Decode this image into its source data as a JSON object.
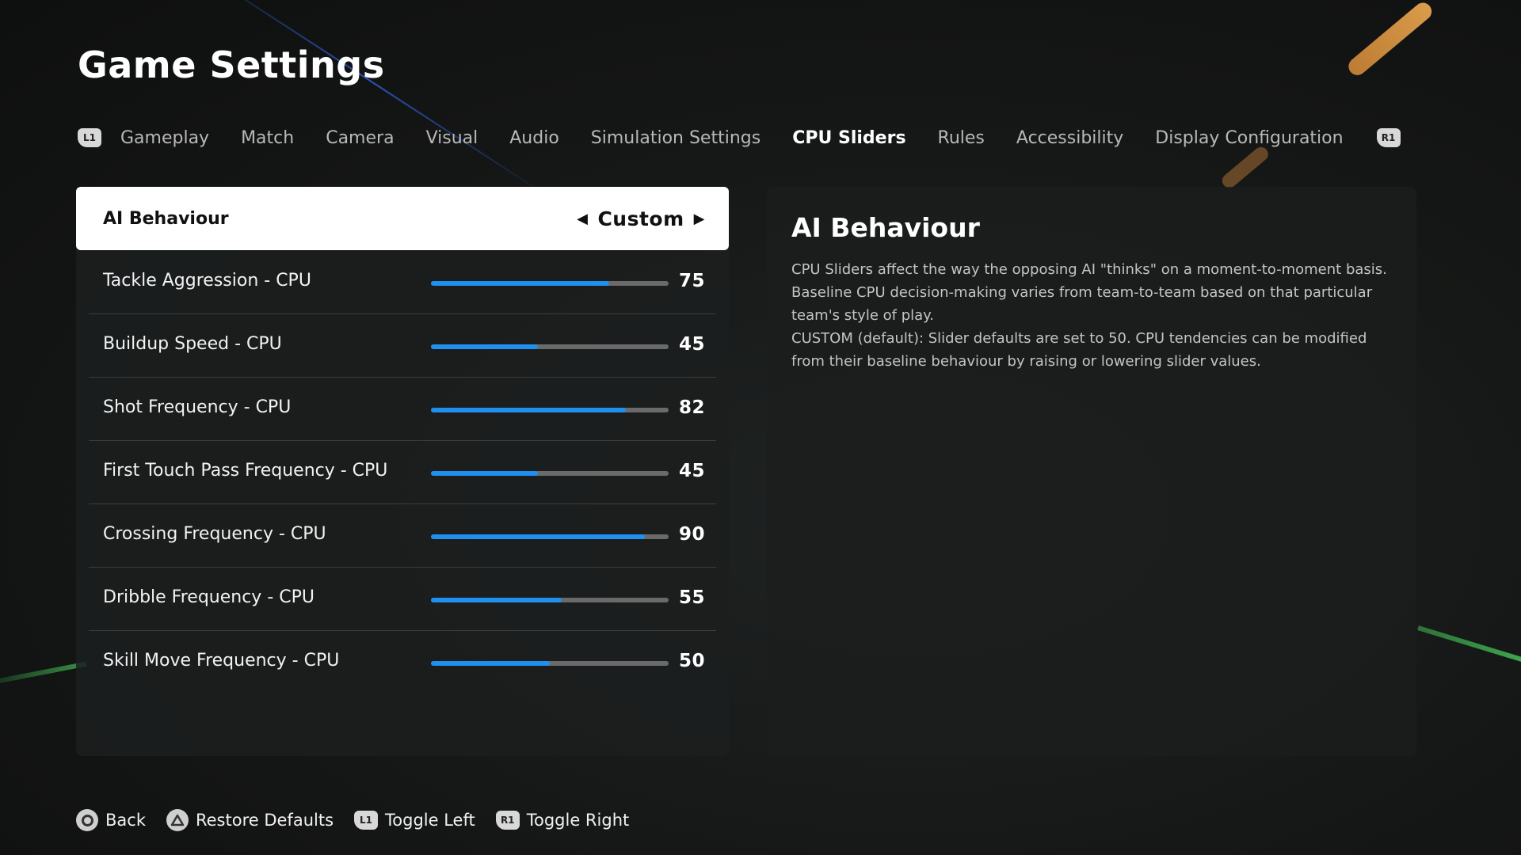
{
  "page": {
    "title": "Game Settings"
  },
  "tabs": {
    "left_button": "L1",
    "right_button": "R1",
    "items": [
      {
        "label": "Gameplay",
        "active": false
      },
      {
        "label": "Match",
        "active": false
      },
      {
        "label": "Camera",
        "active": false
      },
      {
        "label": "Visual",
        "active": false
      },
      {
        "label": "Audio",
        "active": false
      },
      {
        "label": "Simulation Settings",
        "active": false
      },
      {
        "label": "CPU Sliders",
        "active": true
      },
      {
        "label": "Rules",
        "active": false
      },
      {
        "label": "Accessibility",
        "active": false
      },
      {
        "label": "Display Configuration",
        "active": false
      }
    ]
  },
  "settings": {
    "header": {
      "label": "AI Behaviour",
      "value": "Custom",
      "prev_icon": "arrow-left-icon",
      "next_icon": "arrow-right-icon"
    },
    "sliders": [
      {
        "label": "Tackle Aggression - CPU",
        "value": 75
      },
      {
        "label": "Buildup Speed - CPU",
        "value": 45
      },
      {
        "label": "Shot Frequency - CPU",
        "value": 82
      },
      {
        "label": "First Touch Pass Frequency - CPU",
        "value": 45
      },
      {
        "label": "Crossing Frequency - CPU",
        "value": 90
      },
      {
        "label": "Dribble Frequency - CPU",
        "value": 55
      },
      {
        "label": "Skill Move Frequency - CPU",
        "value": 50
      }
    ],
    "slider_max": 100,
    "accent_color": "#1f8ff0"
  },
  "description": {
    "heading": "AI Behaviour",
    "paragraphs": [
      "CPU Sliders affect the way the opposing AI \"thinks\" on a moment-to-moment basis. Baseline CPU decision-making varies from team-to-team based on that particular team's style of play.",
      "CUSTOM (default): Slider defaults are set to 50. CPU tendencies can be modified from their baseline behaviour by raising or lowering slider values."
    ]
  },
  "footer": {
    "hints": [
      {
        "icon": "circle-button-icon",
        "label": "Back"
      },
      {
        "icon": "triangle-button-icon",
        "label": "Restore Defaults"
      },
      {
        "icon": "l1-button-icon",
        "badge": "L1",
        "label": "Toggle Left"
      },
      {
        "icon": "r1-button-icon",
        "badge": "R1",
        "label": "Toggle Right"
      }
    ]
  }
}
